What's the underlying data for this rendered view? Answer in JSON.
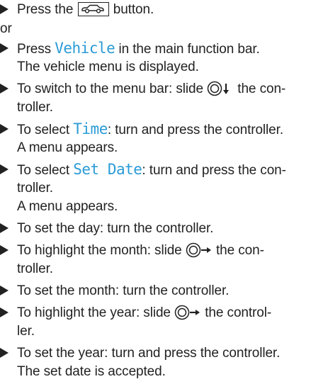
{
  "lines": [
    {
      "pre": "Press the ",
      "post": " button."
    },
    {
      "text": "or"
    },
    {
      "pre": "Press ",
      "hl": "Vehicle",
      "post": " in the main function bar."
    },
    {
      "text": "The vehicle menu is displayed."
    },
    {
      "pre": "To switch to the menu bar: slide ",
      "post": " the con-"
    },
    {
      "text": "troller."
    },
    {
      "pre": "To select ",
      "hl": "Time",
      "post": ": turn and press the controller."
    },
    {
      "text": "A menu appears."
    },
    {
      "pre": "To select ",
      "hl": "Set Date",
      "post": ": turn and press the con-"
    },
    {
      "text": "troller."
    },
    {
      "text": "A menu appears."
    },
    {
      "text": "To set the day: turn the controller."
    },
    {
      "pre": "To highlight the month: slide ",
      "post": " the con-"
    },
    {
      "text": "troller."
    },
    {
      "text": "To set the month: turn the controller."
    },
    {
      "pre": "To highlight the year: slide ",
      "post": " the control-"
    },
    {
      "text": "ler."
    },
    {
      "text": "To set the year: turn and press the controller."
    },
    {
      "text": "The set date is accepted."
    }
  ],
  "icons": {
    "car_button": "vehicle-button-icon",
    "controller_down": "controller-slide-down-icon",
    "controller_right": "controller-slide-right-icon"
  },
  "colors": {
    "text": "#222222",
    "display_text": "#2a9bd6"
  }
}
